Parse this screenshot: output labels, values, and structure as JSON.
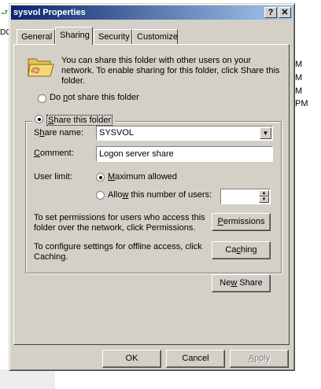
{
  "background": {
    "left_fragment": "DC",
    "right_column": [
      "M",
      "M",
      "M",
      "PM"
    ]
  },
  "dialog": {
    "title": "sysvol Properties",
    "help_button": "?",
    "close_button": "✕"
  },
  "tabs": [
    {
      "label": "General"
    },
    {
      "label": "Sharing"
    },
    {
      "label": "Security"
    },
    {
      "label": "Customize"
    }
  ],
  "sharing": {
    "intro": "You can share this folder with other users on your network.  To enable sharing for this folder, click Share this folder.",
    "do_not_share_pre": "Do ",
    "do_not_share_u": "n",
    "do_not_share_post": "ot share this folder",
    "share_this_pre": "",
    "share_this_u": "S",
    "share_this_post": "hare this folder",
    "share_name_label_pre": "S",
    "share_name_label_u": "h",
    "share_name_label_post": "are name:",
    "share_name_value": "SYSVOL",
    "comment_label_pre": "",
    "comment_label_u": "C",
    "comment_label_post": "omment:",
    "comment_value": "Logon server share",
    "user_limit_label": "User limit:",
    "max_allowed_pre": "",
    "max_allowed_u": "M",
    "max_allowed_post": "aximum allowed",
    "allow_users_pre": "Allo",
    "allow_users_u": "w",
    "allow_users_post": " this number of users:",
    "allow_users_value": "",
    "permissions_text": "To set permissions for users who access this folder over the network, click Permissions.",
    "permissions_button_pre": "",
    "permissions_button_u": "P",
    "permissions_button_post": "ermissions",
    "caching_text": "To configure settings for offline access, click Caching.",
    "caching_button_pre": "Ca",
    "caching_button_u": "c",
    "caching_button_post": "hing",
    "new_share_pre": "Ne",
    "new_share_u": "w",
    "new_share_post": " Share",
    "selected_option": "share_this_folder",
    "user_limit_option": "maximum_allowed"
  },
  "footer": {
    "ok": "OK",
    "cancel": "Cancel",
    "apply_pre": "",
    "apply_u": "A",
    "apply_post": "pply"
  },
  "colors": {
    "dialog_face": "#d4d0c8",
    "titlebar_start": "#0a246a",
    "titlebar_end": "#a6caf0"
  }
}
